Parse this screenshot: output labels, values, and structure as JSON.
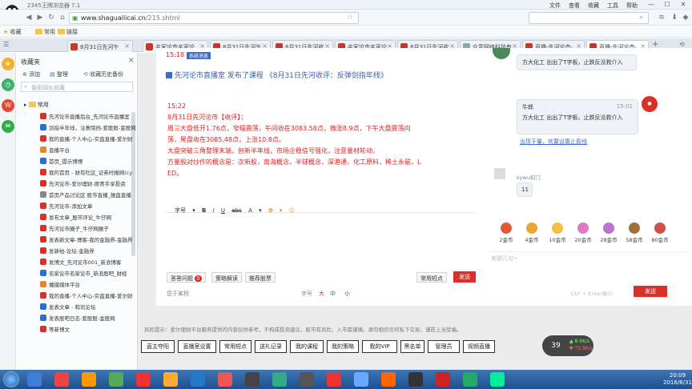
{
  "window": {
    "title": "2345王牌浏览器 7.1",
    "menus": [
      "文件",
      "查看",
      "收藏",
      "工具",
      "帮助"
    ],
    "controls": [
      "—",
      "☐",
      "✕"
    ]
  },
  "address": {
    "url_host": "www.shaguailicai.cn",
    "url_path": "/215.shtml"
  },
  "bookmarks_bar": [
    "收藏",
    "常用",
    "链接"
  ],
  "tabs": [
    {
      "label": "8月31日先河午"
    },
    {
      "label": "名家论市名家论"
    },
    {
      "label": "8月31日先河午"
    },
    {
      "label": "8月31日先河收"
    },
    {
      "label": "名家论市名家论"
    },
    {
      "label": "8月31日先河收"
    },
    {
      "label": "众富网络科技有"
    },
    {
      "label": "直播-先河论市-"
    },
    {
      "label": "直播-先河论市-"
    }
  ],
  "favorites": {
    "header": "收藏夹",
    "close": "✕",
    "tools": [
      "添加",
      "整理",
      "收藏历史备份"
    ],
    "search_placeholder": "搜索网址收藏",
    "folder": "常用",
    "items": [
      "先河论市直播后台_先河论市直播室",
      "剑指半年线，注意阻挡-爱股股-金股网",
      "我的直播-个人中心-实盘直播-爱尔财",
      "直播平台",
      "首页_提示博博",
      "我的首页 - 财有社区_证券时报网(cy",
      "先河论市-爱尔理财-原青手享投资",
      "首页产品讨论区 股市直播_操盘直播",
      "先河论市-添加文章",
      "发布文章_股市评论_牛仔网",
      "先河论市圈子_牛仔网圈子",
      "发表新文章-博客-我的金融界-金融界",
      "发新帖-论坛-金融界",
      "发博文_先河论市001_新浪博客",
      "名家论市名家论市_新浪股吧_财经",
      "播摸媒体平台",
      "我的直播-个人中心-实盘直播-爱尔财",
      "发表文章 - 和讯论坛",
      "发表股吧日志-爱股股-金股网",
      "等新博文"
    ]
  },
  "post": {
    "time_top": "15:18",
    "badge": "系统消息",
    "sticky": "先河论市直播室 发布了课程 《8月31日先河收评：反弹剑指年线》",
    "time": "15:22",
    "header": "8月31日先河论市【收评】：",
    "lines": [
      "周三大盘低开1.76点，窄幅震荡，午间收在3083.58点，微涨8.9点，下午大盘震荡向",
      "荡，尾盘收在3085.48点，上涨10.8点。",
      "大盘突破三角整理末端，创新半年线，市场企稳信号强化，注意量材轮动。",
      "方量股对炒作的概念是：次新股，南海概念，半球概念，深港通，化工原料，稀土永磁，L",
      "ED。"
    ]
  },
  "editor": {
    "font_label": "字号",
    "tools": [
      "B",
      "I",
      "U",
      "abc",
      "A",
      "✿"
    ],
    "buttons": [
      "答答问题",
      "0",
      "策略解读",
      "推荐股票"
    ],
    "common_words": "常用短点",
    "send": "发送",
    "remaining": "您于某税",
    "font_size_label": "字号",
    "font_size_options": [
      "大",
      "中",
      "小"
    ]
  },
  "chat": {
    "top_message": "方大化工 出出了T字板，止跌反没救介入",
    "avatar_name": "牛郎",
    "time": "15:01",
    "message": "方大化工 出出了T字板，止跌反没救介入",
    "link": "出现干量，欢要设置止盈线",
    "user2": "kywu扣门",
    "user2_msg": "11",
    "gifts": [
      {
        "name": "2金币",
        "color": "#e05a3a"
      },
      {
        "name": "4金币",
        "color": "#e8a830"
      },
      {
        "name": "10金币",
        "color": "#f0c040"
      },
      {
        "name": "20金币",
        "color": "#e07ac0"
      },
      {
        "name": "28金币",
        "color": "#c070d0"
      },
      {
        "name": "58金币",
        "color": "#a0703a"
      },
      {
        "name": "80金币",
        "color": "#d0504a"
      }
    ],
    "input_placeholder": "来聊几句~",
    "bottom_hint": "Ctrl + Enter换行",
    "send": "发送"
  },
  "footer_text": "风险提示：爱尔理财平台服务提供的内容仅供参考，不构成投资建议，股市有风险，入市需谨慎。请勿相信任何私下交易，谨防上当受骗。",
  "nav_buttons": [
    "直主夺阳",
    "直播室设置",
    "常用短点",
    "送礼记录",
    "我的课程",
    "我的策略",
    "我的VIP",
    "黑名单",
    "管理员",
    "视频直播"
  ],
  "net": {
    "percent": "39",
    "up": "8.6K/s",
    "down": "75.9K/s"
  },
  "taskbar": {
    "time": "20:09",
    "date": "2016/8/31",
    "icons_colors": [
      "#3b7dd8",
      "#e44",
      "#f90",
      "#5a5",
      "#e33",
      "#fa3",
      "#27c",
      "#e55",
      "#444",
      "#3a8",
      "#555",
      "#e33",
      "#6af",
      "#f60",
      "#333",
      "#c22",
      "#2a6",
      "#0e9",
      "#f5b",
      "#ee3"
    ]
  }
}
